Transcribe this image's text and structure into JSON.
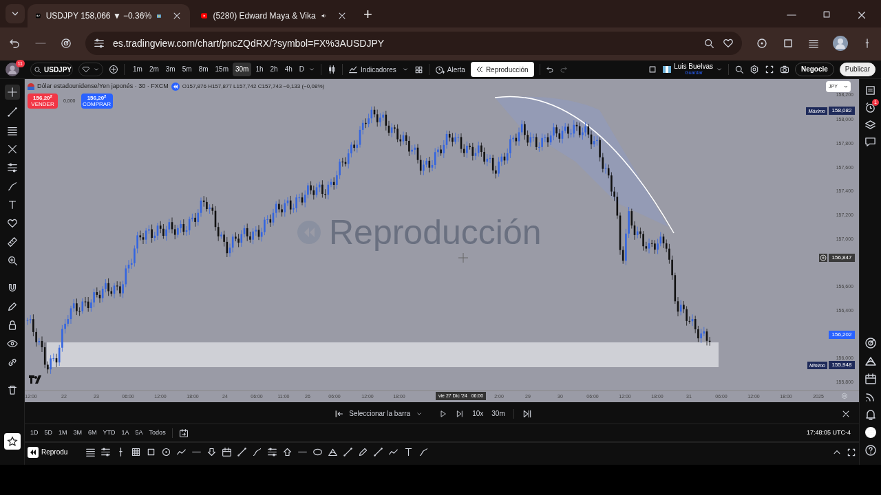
{
  "browser": {
    "tabs": [
      {
        "title": "USDJPY 158,066 ▼ −0.36%",
        "selected": true,
        "kind": "tv"
      },
      {
        "title": "(5280) Edward Maya & Vika",
        "selected": false,
        "kind": "video"
      }
    ],
    "new_tab": "+",
    "address": "es.tradingview.com/chart/pncZQdRX/?symbol=FX%3AUSDJPY"
  },
  "toolbar": {
    "avatar_badge": "11",
    "symbol": "USDJPY",
    "intervals": [
      {
        "label": "1m",
        "selected": false
      },
      {
        "label": "2m",
        "selected": false
      },
      {
        "label": "3m",
        "selected": false
      },
      {
        "label": "5m",
        "selected": false
      },
      {
        "label": "8m",
        "selected": false
      },
      {
        "label": "15m",
        "selected": false
      },
      {
        "label": "30m",
        "selected": true
      },
      {
        "label": "1h",
        "selected": false
      },
      {
        "label": "2h",
        "selected": false
      },
      {
        "label": "4h",
        "selected": false
      },
      {
        "label": "D",
        "selected": false
      }
    ],
    "indicators": "Indicadores",
    "alert": "Alerta",
    "replay": "Reproducción",
    "layout_name": "Luis Buelvas",
    "layout_save": "Guardar",
    "trade": "Negocie",
    "publish": "Publicar"
  },
  "chart": {
    "title": "Dólar estadounidense/Yen japonés · 30 · FXCM",
    "ohlc": "O157,876 H157,877 L157,742 C157,743 −0,133 (−0,08%)",
    "sell": {
      "price": "156,20$^{2}$",
      "label": "VENDER"
    },
    "spread": "0,000",
    "buy": {
      "price": "156,20$^{2}$",
      "label": "COMPRAR"
    },
    "currency": "JPY",
    "watermark": "Reproducción",
    "price_ticks": [
      "158,200",
      "158,000",
      "157,800",
      "157,600",
      "157,400",
      "157,200",
      "157,000",
      "156,600",
      "156,400",
      "156,000",
      "155,800"
    ],
    "price_badges": [
      {
        "kind": "max",
        "label": "Máximo",
        "value": "158,082"
      },
      {
        "kind": "cross",
        "value": "156,847"
      },
      {
        "kind": "last",
        "value": "156,202"
      },
      {
        "kind": "min",
        "label": "Mínimo",
        "value": "155,948"
      }
    ],
    "time_ticks": [
      "12:00",
      "22",
      "23",
      "06:00",
      "12:00",
      "18:00",
      "24",
      "06:00",
      "11:00",
      "26",
      "06:00",
      "12:00",
      "18:00",
      "2:00",
      "29",
      "30",
      "06:00",
      "12:00",
      "18:00",
      "31",
      "06:00",
      "12:00",
      "18:00",
      "2025"
    ],
    "time_cursor": "vie 27 Dic '24   06:00"
  },
  "replay_bar": {
    "select_bar": "Seleccionar la barra",
    "speed": "10x",
    "interval": "30m"
  },
  "ranges": [
    "1D",
    "5D",
    "1M",
    "3M",
    "6M",
    "YTD",
    "1A",
    "5A",
    "Todos"
  ],
  "clock": "17:48:05 UTC-4",
  "drawing_bar": {
    "replay_button": "Reprodu"
  },
  "alerts_badge": "1"
}
